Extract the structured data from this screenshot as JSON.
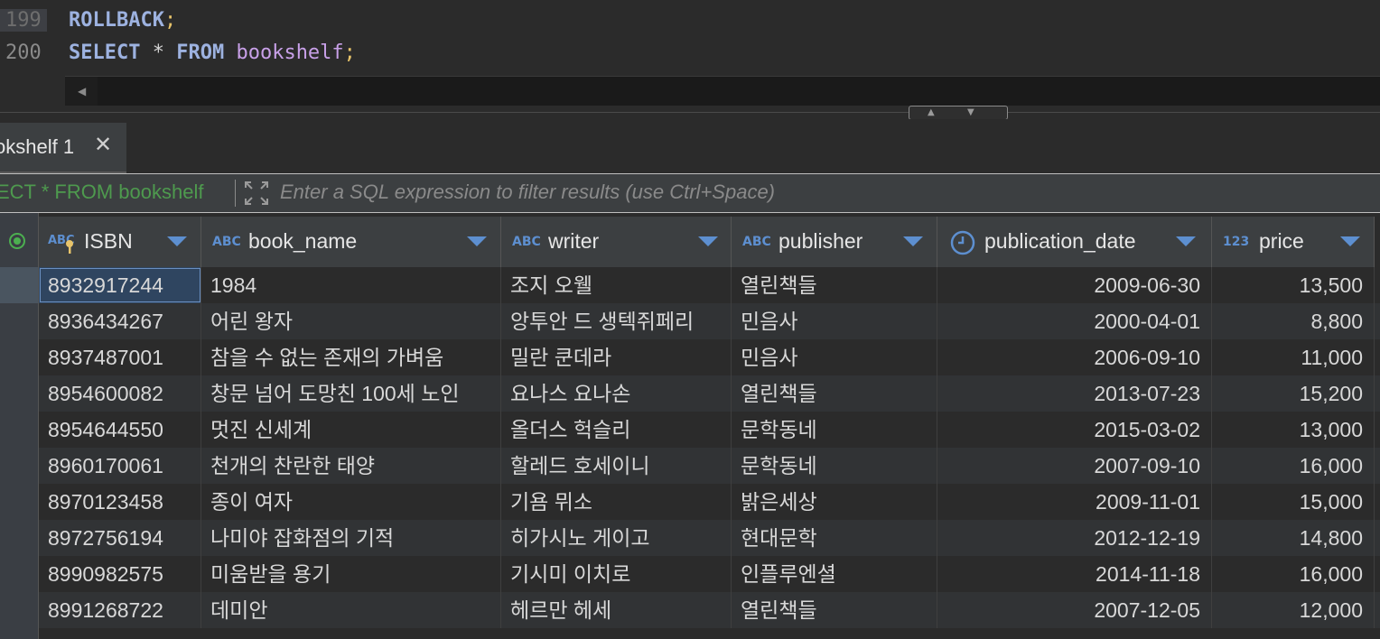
{
  "editor": {
    "lines": [
      {
        "num": "199",
        "current": true
      },
      {
        "num": "200",
        "current": false
      }
    ],
    "line199": {
      "kw": "ROLLBACK",
      "semi": ";"
    },
    "line200": {
      "kw1": "SELECT",
      "op": " * ",
      "kw2": "FROM",
      "ident": " bookshelf",
      "semi": ";"
    }
  },
  "result_tab": {
    "label": "okshelf 1"
  },
  "filter": {
    "query": "ECT * FROM bookshelf",
    "placeholder": "Enter a SQL expression to filter results (use Ctrl+Space)"
  },
  "columns": [
    {
      "type": "ABC",
      "name": "ISBN",
      "icon": "key-icon"
    },
    {
      "type": "ABC",
      "name": "book_name",
      "icon": "text-type-icon"
    },
    {
      "type": "ABC",
      "name": "writer",
      "icon": "text-type-icon"
    },
    {
      "type": "ABC",
      "name": "publisher",
      "icon": "text-type-icon"
    },
    {
      "type": "",
      "name": "publication_date",
      "icon": "clock-icon"
    },
    {
      "type": "123",
      "name": "price",
      "icon": "number-type-icon"
    }
  ],
  "rows": [
    {
      "isbn": "8932917244",
      "book_name": "1984",
      "writer": "조지 오웰",
      "publisher": "열린책들",
      "date": "2009-06-30",
      "price": "13,500"
    },
    {
      "isbn": "8936434267",
      "book_name": "어린 왕자",
      "writer": "앙투안 드 생텍쥐페리",
      "publisher": "민음사",
      "date": "2000-04-01",
      "price": "8,800"
    },
    {
      "isbn": "8937487001",
      "book_name": "참을 수 없는 존재의 가벼움",
      "writer": "밀란 쿤데라",
      "publisher": "민음사",
      "date": "2006-09-10",
      "price": "11,000"
    },
    {
      "isbn": "8954600082",
      "book_name": "창문 넘어 도망친 100세 노인",
      "writer": "요나스 요나손",
      "publisher": "열린책들",
      "date": "2013-07-23",
      "price": "15,200"
    },
    {
      "isbn": "8954644550",
      "book_name": "멋진 신세계",
      "writer": "올더스 헉슬리",
      "publisher": "문학동네",
      "date": "2015-03-02",
      "price": "13,000"
    },
    {
      "isbn": "8960170061",
      "book_name": "천개의 찬란한 태양",
      "writer": "할레드 호세이니",
      "publisher": "문학동네",
      "date": "2007-09-10",
      "price": "16,000"
    },
    {
      "isbn": "8970123458",
      "book_name": "종이 여자",
      "writer": "기욤 뮈소",
      "publisher": "밝은세상",
      "date": "2009-11-01",
      "price": "15,000"
    },
    {
      "isbn": "8972756194",
      "book_name": "나미야 잡화점의 기적",
      "writer": "히가시노 게이고",
      "publisher": "현대문학",
      "date": "2012-12-19",
      "price": "14,800"
    },
    {
      "isbn": "8990982575",
      "book_name": "미움받을 용기",
      "writer": "기시미 이치로",
      "publisher": "인플루엔셜",
      "date": "2014-11-18",
      "price": "16,000"
    },
    {
      "isbn": "8991268722",
      "book_name": "데미안",
      "writer": "헤르만 헤세",
      "publisher": "열린책들",
      "date": "2007-12-05",
      "price": "12,000"
    }
  ],
  "colors": {
    "keyword": "#9db2e0",
    "identifier": "#c8a0e8",
    "semicolon": "#e8c46a",
    "accent": "#5d8fd0",
    "filter_query": "#4e9a4e"
  }
}
